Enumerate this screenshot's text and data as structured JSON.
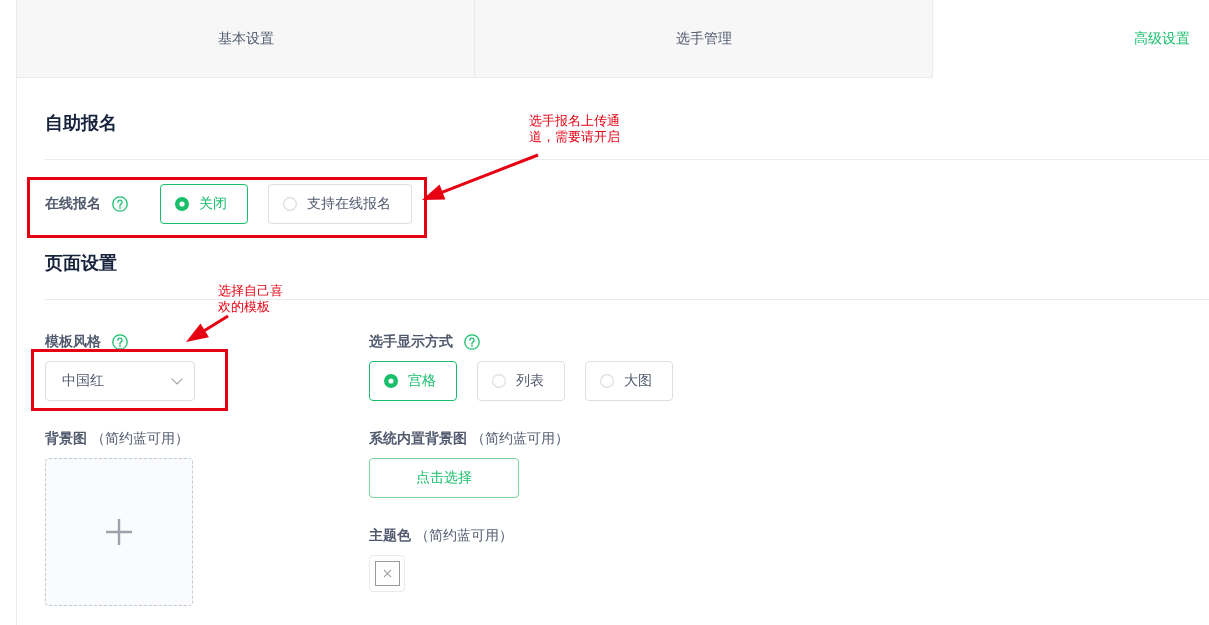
{
  "tabs": [
    {
      "label": "基本设置",
      "selected": false
    },
    {
      "label": "选手管理",
      "selected": false
    },
    {
      "label": "高级设置",
      "selected": true
    }
  ],
  "sections": [
    {
      "title": "自助报名",
      "fields": [
        {
          "kind": "radio-group",
          "label": "在线报名",
          "help": true,
          "options": [
            {
              "label": "关闭",
              "selected": true
            },
            {
              "label": "支持在线报名",
              "selected": false
            }
          ]
        }
      ]
    },
    {
      "title": "页面设置",
      "columns": [
        [
          {
            "kind": "select",
            "label": "模板风格",
            "help": true,
            "value": "中国红"
          },
          {
            "kind": "upload",
            "label": "背景图",
            "note": "（简约蓝可用）"
          }
        ],
        [
          {
            "kind": "radio-group",
            "label": "选手显示方式",
            "help": true,
            "options": [
              {
                "label": "宫格",
                "selected": true
              },
              {
                "label": "列表",
                "selected": false
              },
              {
                "label": "大图",
                "selected": false
              }
            ]
          },
          {
            "kind": "button",
            "label": "系统内置背景图",
            "note": "（简约蓝可用）",
            "button": "点击选择"
          },
          {
            "kind": "color",
            "label": "主题色",
            "note": "（简约蓝可用）"
          }
        ]
      ]
    }
  ],
  "annotations": [
    {
      "text": "选手报名上传通道，需要请开启"
    },
    {
      "text": "选择自己喜欢的模板"
    }
  ]
}
